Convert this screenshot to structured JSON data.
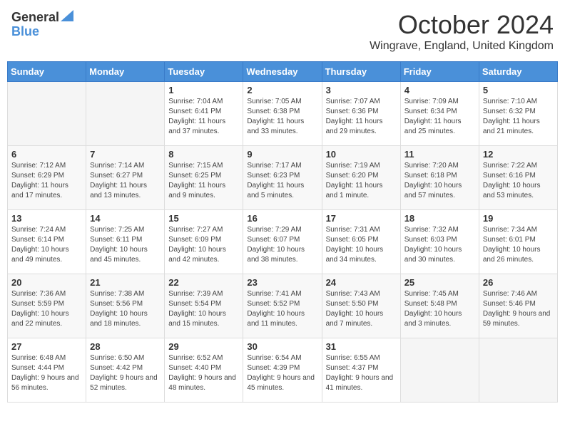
{
  "header": {
    "logo_general": "General",
    "logo_blue": "Blue",
    "title": "October 2024",
    "location": "Wingrave, England, United Kingdom"
  },
  "days_of_week": [
    "Sunday",
    "Monday",
    "Tuesday",
    "Wednesday",
    "Thursday",
    "Friday",
    "Saturday"
  ],
  "weeks": [
    [
      {
        "day": "",
        "detail": ""
      },
      {
        "day": "",
        "detail": ""
      },
      {
        "day": "1",
        "detail": "Sunrise: 7:04 AM\nSunset: 6:41 PM\nDaylight: 11 hours and 37 minutes."
      },
      {
        "day": "2",
        "detail": "Sunrise: 7:05 AM\nSunset: 6:38 PM\nDaylight: 11 hours and 33 minutes."
      },
      {
        "day": "3",
        "detail": "Sunrise: 7:07 AM\nSunset: 6:36 PM\nDaylight: 11 hours and 29 minutes."
      },
      {
        "day": "4",
        "detail": "Sunrise: 7:09 AM\nSunset: 6:34 PM\nDaylight: 11 hours and 25 minutes."
      },
      {
        "day": "5",
        "detail": "Sunrise: 7:10 AM\nSunset: 6:32 PM\nDaylight: 11 hours and 21 minutes."
      }
    ],
    [
      {
        "day": "6",
        "detail": "Sunrise: 7:12 AM\nSunset: 6:29 PM\nDaylight: 11 hours and 17 minutes."
      },
      {
        "day": "7",
        "detail": "Sunrise: 7:14 AM\nSunset: 6:27 PM\nDaylight: 11 hours and 13 minutes."
      },
      {
        "day": "8",
        "detail": "Sunrise: 7:15 AM\nSunset: 6:25 PM\nDaylight: 11 hours and 9 minutes."
      },
      {
        "day": "9",
        "detail": "Sunrise: 7:17 AM\nSunset: 6:23 PM\nDaylight: 11 hours and 5 minutes."
      },
      {
        "day": "10",
        "detail": "Sunrise: 7:19 AM\nSunset: 6:20 PM\nDaylight: 11 hours and 1 minute."
      },
      {
        "day": "11",
        "detail": "Sunrise: 7:20 AM\nSunset: 6:18 PM\nDaylight: 10 hours and 57 minutes."
      },
      {
        "day": "12",
        "detail": "Sunrise: 7:22 AM\nSunset: 6:16 PM\nDaylight: 10 hours and 53 minutes."
      }
    ],
    [
      {
        "day": "13",
        "detail": "Sunrise: 7:24 AM\nSunset: 6:14 PM\nDaylight: 10 hours and 49 minutes."
      },
      {
        "day": "14",
        "detail": "Sunrise: 7:25 AM\nSunset: 6:11 PM\nDaylight: 10 hours and 45 minutes."
      },
      {
        "day": "15",
        "detail": "Sunrise: 7:27 AM\nSunset: 6:09 PM\nDaylight: 10 hours and 42 minutes."
      },
      {
        "day": "16",
        "detail": "Sunrise: 7:29 AM\nSunset: 6:07 PM\nDaylight: 10 hours and 38 minutes."
      },
      {
        "day": "17",
        "detail": "Sunrise: 7:31 AM\nSunset: 6:05 PM\nDaylight: 10 hours and 34 minutes."
      },
      {
        "day": "18",
        "detail": "Sunrise: 7:32 AM\nSunset: 6:03 PM\nDaylight: 10 hours and 30 minutes."
      },
      {
        "day": "19",
        "detail": "Sunrise: 7:34 AM\nSunset: 6:01 PM\nDaylight: 10 hours and 26 minutes."
      }
    ],
    [
      {
        "day": "20",
        "detail": "Sunrise: 7:36 AM\nSunset: 5:59 PM\nDaylight: 10 hours and 22 minutes."
      },
      {
        "day": "21",
        "detail": "Sunrise: 7:38 AM\nSunset: 5:56 PM\nDaylight: 10 hours and 18 minutes."
      },
      {
        "day": "22",
        "detail": "Sunrise: 7:39 AM\nSunset: 5:54 PM\nDaylight: 10 hours and 15 minutes."
      },
      {
        "day": "23",
        "detail": "Sunrise: 7:41 AM\nSunset: 5:52 PM\nDaylight: 10 hours and 11 minutes."
      },
      {
        "day": "24",
        "detail": "Sunrise: 7:43 AM\nSunset: 5:50 PM\nDaylight: 10 hours and 7 minutes."
      },
      {
        "day": "25",
        "detail": "Sunrise: 7:45 AM\nSunset: 5:48 PM\nDaylight: 10 hours and 3 minutes."
      },
      {
        "day": "26",
        "detail": "Sunrise: 7:46 AM\nSunset: 5:46 PM\nDaylight: 9 hours and 59 minutes."
      }
    ],
    [
      {
        "day": "27",
        "detail": "Sunrise: 6:48 AM\nSunset: 4:44 PM\nDaylight: 9 hours and 56 minutes."
      },
      {
        "day": "28",
        "detail": "Sunrise: 6:50 AM\nSunset: 4:42 PM\nDaylight: 9 hours and 52 minutes."
      },
      {
        "day": "29",
        "detail": "Sunrise: 6:52 AM\nSunset: 4:40 PM\nDaylight: 9 hours and 48 minutes."
      },
      {
        "day": "30",
        "detail": "Sunrise: 6:54 AM\nSunset: 4:39 PM\nDaylight: 9 hours and 45 minutes."
      },
      {
        "day": "31",
        "detail": "Sunrise: 6:55 AM\nSunset: 4:37 PM\nDaylight: 9 hours and 41 minutes."
      },
      {
        "day": "",
        "detail": ""
      },
      {
        "day": "",
        "detail": ""
      }
    ]
  ]
}
